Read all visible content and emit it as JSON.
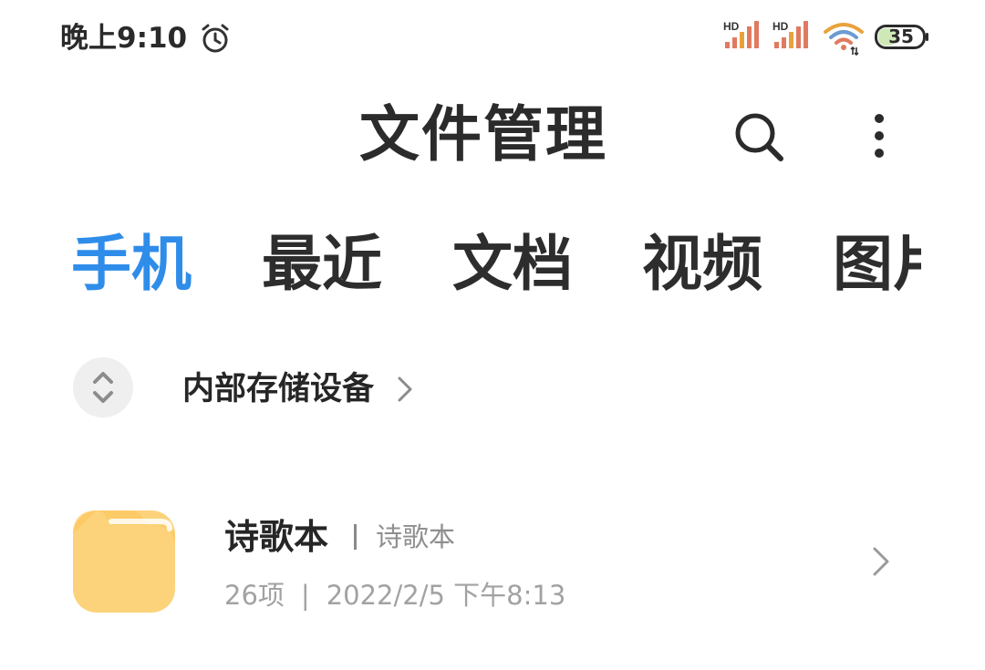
{
  "status_bar": {
    "time": "晚上9:10",
    "alarm_icon": "alarm-clock-icon",
    "signal_1": {
      "label": "HD",
      "icon": "cellular-signal-icon"
    },
    "signal_2": {
      "label": "HD",
      "icon": "cellular-signal-icon"
    },
    "wifi_icon": "wifi-icon",
    "battery_level": "35"
  },
  "header": {
    "title": "文件管理",
    "search_icon": "search-icon",
    "more_icon": "more-vertical-icon"
  },
  "tabs": [
    {
      "label": "手机",
      "active": true
    },
    {
      "label": "最近",
      "active": false
    },
    {
      "label": "文档",
      "active": false
    },
    {
      "label": "视频",
      "active": false
    },
    {
      "label": "图片",
      "active": false
    }
  ],
  "storage": {
    "switch_icon": "expand-collapse-icon",
    "label": "内部存储设备",
    "chevron_icon": "chevron-right-icon"
  },
  "folders": [
    {
      "name": "诗歌本",
      "alias": "诗歌本",
      "count": "26项",
      "modified": "2022/2/5 下午8:13",
      "icon": "folder-icon"
    }
  ],
  "colors": {
    "accent": "#2f8dea",
    "text_primary": "#262626",
    "text_secondary": "#a2a2a2",
    "folder": "#fcd37a",
    "background": "#ffffff"
  }
}
